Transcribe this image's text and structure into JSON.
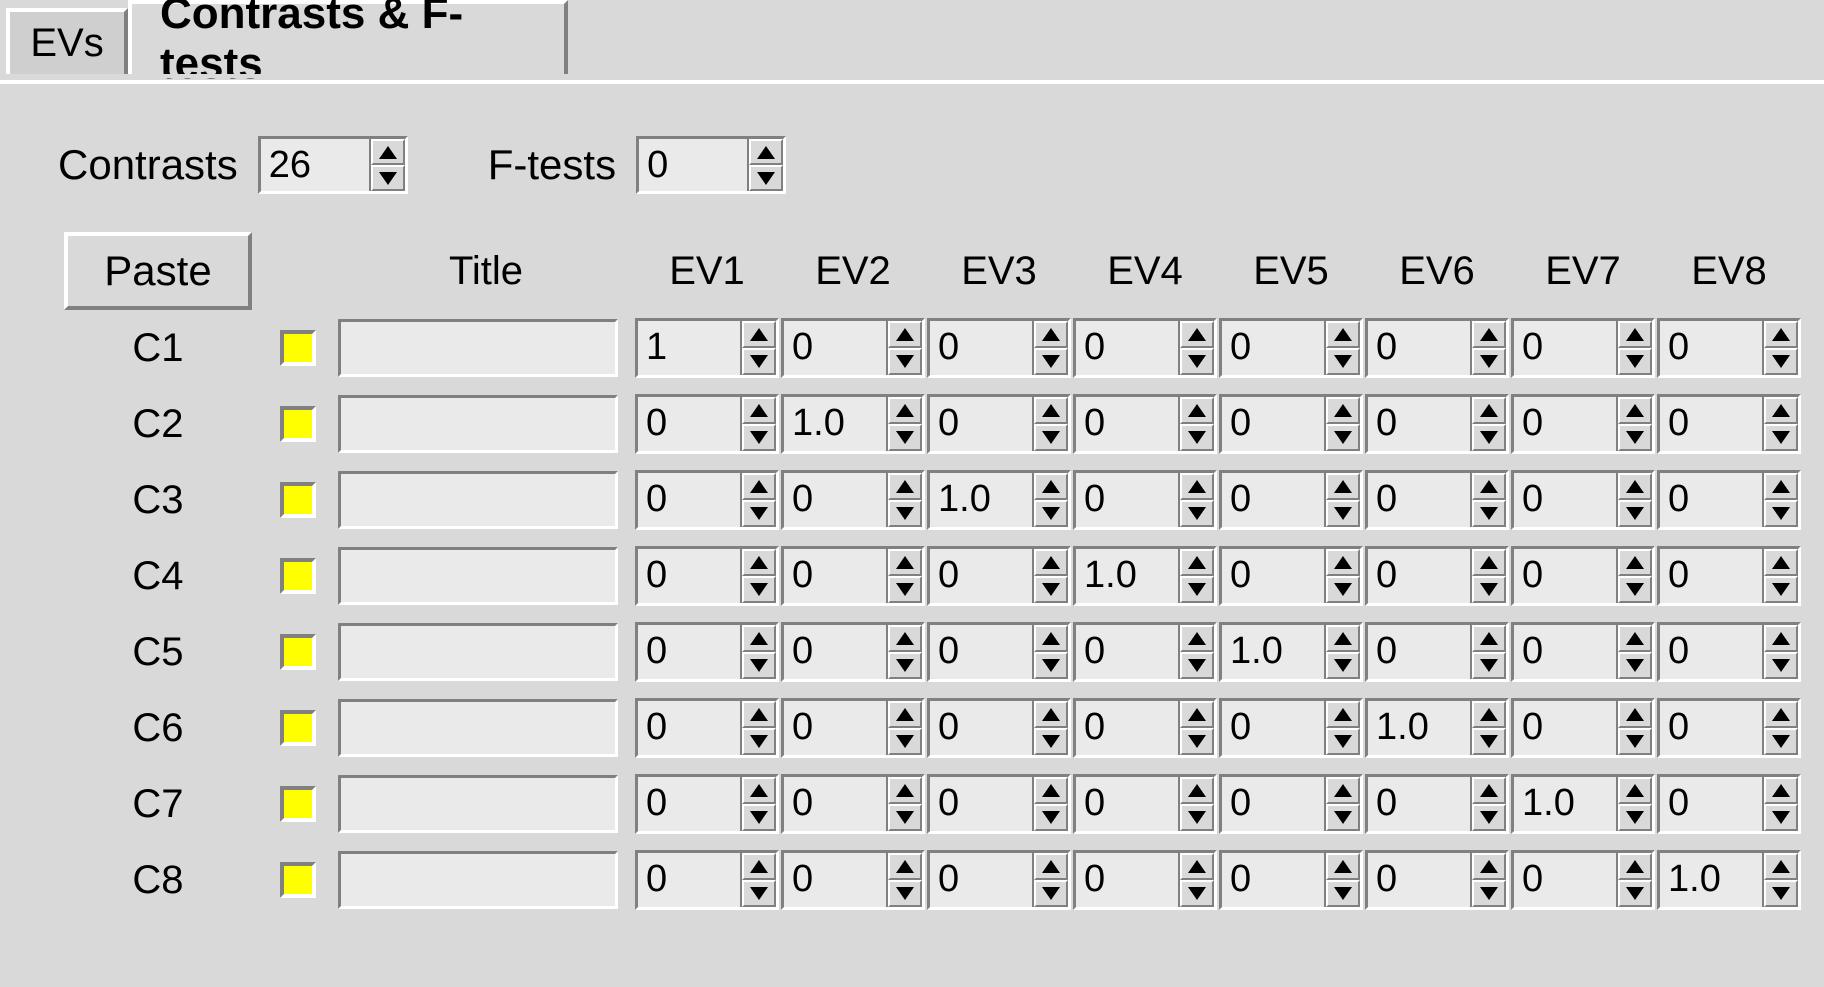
{
  "tabs": {
    "evs_label": "EVs",
    "contrasts_label": "Contrasts & F-tests"
  },
  "controls": {
    "contrasts_label": "Contrasts",
    "contrasts_value": "26",
    "ftests_label": "F-tests",
    "ftests_value": "0",
    "paste_label": "Paste"
  },
  "headers": {
    "title": "Title",
    "ev": [
      "EV1",
      "EV2",
      "EV3",
      "EV4",
      "EV5",
      "EV6",
      "EV7",
      "EV8"
    ]
  },
  "rows": [
    {
      "id": "C1",
      "title": "",
      "ev": [
        "1",
        "0",
        "0",
        "0",
        "0",
        "0",
        "0",
        "0"
      ]
    },
    {
      "id": "C2",
      "title": "",
      "ev": [
        "0",
        "1.0",
        "0",
        "0",
        "0",
        "0",
        "0",
        "0"
      ]
    },
    {
      "id": "C3",
      "title": "",
      "ev": [
        "0",
        "0",
        "1.0",
        "0",
        "0",
        "0",
        "0",
        "0"
      ]
    },
    {
      "id": "C4",
      "title": "",
      "ev": [
        "0",
        "0",
        "0",
        "1.0",
        "0",
        "0",
        "0",
        "0"
      ]
    },
    {
      "id": "C5",
      "title": "",
      "ev": [
        "0",
        "0",
        "0",
        "0",
        "1.0",
        "0",
        "0",
        "0"
      ]
    },
    {
      "id": "C6",
      "title": "",
      "ev": [
        "0",
        "0",
        "0",
        "0",
        "0",
        "1.0",
        "0",
        "0"
      ]
    },
    {
      "id": "C7",
      "title": "",
      "ev": [
        "0",
        "0",
        "0",
        "0",
        "0",
        "0",
        "1.0",
        "0"
      ]
    },
    {
      "id": "C8",
      "title": "",
      "ev": [
        "0",
        "0",
        "0",
        "0",
        "0",
        "0",
        "0",
        "1.0"
      ]
    }
  ]
}
